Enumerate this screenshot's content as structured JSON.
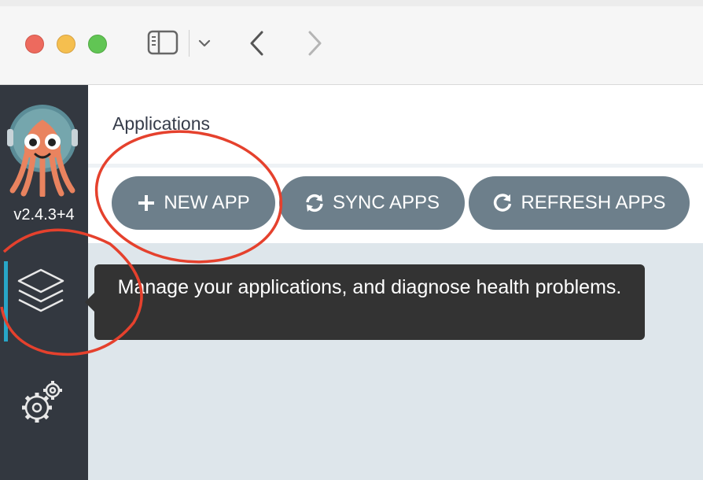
{
  "window": {
    "traffic_lights": [
      "close",
      "minimize",
      "zoom"
    ],
    "toolbar_icons": [
      "sidebar-toggle-icon",
      "chevron-down-icon",
      "back-arrow-icon",
      "forward-arrow-icon"
    ]
  },
  "sidebar": {
    "logo": "argo-logo",
    "version": "v2.4.3+4",
    "items": [
      {
        "icon": "layers-icon",
        "active": true
      },
      {
        "icon": "settings-gears-icon",
        "active": false
      }
    ]
  },
  "header": {
    "title": "Applications"
  },
  "toolbar": {
    "buttons": [
      {
        "label": "NEW APP",
        "icon": "plus-icon"
      },
      {
        "label": "SYNC APPS",
        "icon": "sync-icon"
      },
      {
        "label": "REFRESH APPS",
        "icon": "refresh-icon"
      }
    ]
  },
  "tooltip": {
    "text": "Manage your applications, and diagnose health problems."
  },
  "colors": {
    "sidebar_bg": "#333840",
    "button_bg": "#6d7f8b",
    "active_indicator": "#28a6c8",
    "content_bg": "#dee6eb",
    "annotation_red": "#e5412d"
  }
}
